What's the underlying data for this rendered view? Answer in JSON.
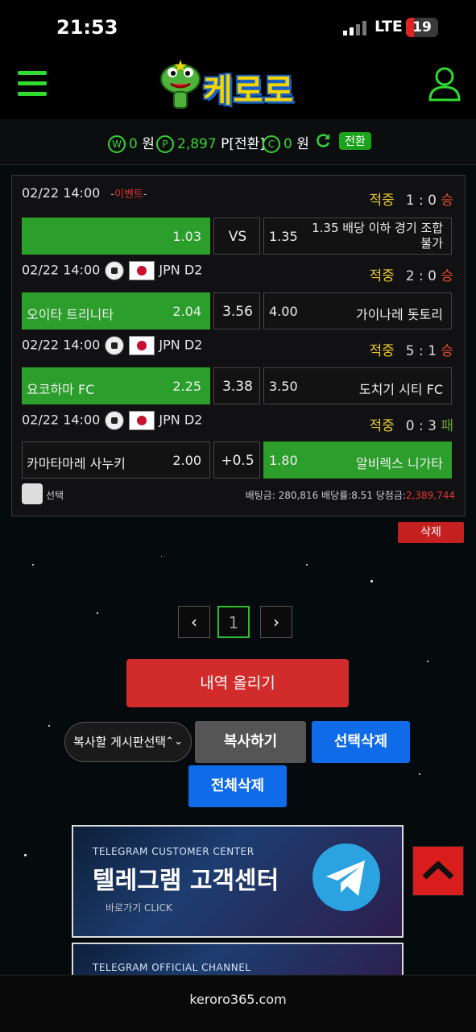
{
  "status_bar": {
    "time": "21:53",
    "network": "LTE",
    "battery": "19"
  },
  "header": {
    "logo_text": "케로로",
    "menu_icon": "hamburger-icon",
    "user_icon": "user-icon"
  },
  "points": {
    "won_value": "0",
    "won_unit": "원",
    "point_value": "2,897",
    "point_unit": "P[전환]",
    "coin_value": "0",
    "coin_unit": "원",
    "convert_label": "전환"
  },
  "bets": [
    {
      "date": "02/22 14:00",
      "league": "이벤트",
      "status": "적중",
      "score": "1 : 0",
      "outcome": "승",
      "home": "",
      "home_odds": "1.03",
      "mid": "VS",
      "away_odds": "1.35",
      "away": "1.35 배당 이하 경기 조합 불가"
    },
    {
      "date": "02/22 14:00",
      "league": "JPN D2",
      "status": "적중",
      "score": "2 : 0",
      "outcome": "승",
      "home": "오이타 트리니타",
      "home_odds": "2.04",
      "mid": "3.56",
      "away_odds": "4.00",
      "away": "가이나레 돗토리"
    },
    {
      "date": "02/22 14:00",
      "league": "JPN D2",
      "status": "적중",
      "score": "5 : 1",
      "outcome": "승",
      "home": "요코하마 FC",
      "home_odds": "2.25",
      "mid": "3.38",
      "away_odds": "3.50",
      "away": "도치기 시티 FC"
    },
    {
      "date": "02/22 14:00",
      "league": "JPN D2",
      "status": "적중",
      "score": "0 : 3",
      "outcome": "패",
      "home": "카마타마레 사누키",
      "home_odds": "2.00",
      "mid": "+0.5",
      "away_odds": "1.80",
      "away": "알비렉스 니가타"
    }
  ],
  "summary": {
    "select_label": "선택",
    "bet_amount_label": "배팅금:",
    "bet_amount": "280,816",
    "odds_label": "배당률:",
    "odds": "8.51",
    "win_label": "당첨금:",
    "win_amount": "2,389,744"
  },
  "delete_label": "삭제",
  "pagination": {
    "prev": "‹",
    "current": "1",
    "next": "›"
  },
  "upload_label": "내역 올리기",
  "board_select_placeholder": "복사할 게시판선택",
  "copy_label": "복사하기",
  "select_delete_label": "선택삭제",
  "all_delete_label": "전체삭제",
  "banner1": {
    "subtitle": "TELEGRAM CUSTOMER CENTER",
    "title": "텔레그램 고객센터",
    "link": "바로가기 CLICK"
  },
  "banner2": {
    "subtitle": "TELEGRAM OFFICIAL CHANNEL"
  },
  "footer_url": "keroro365.com",
  "colors": {
    "green": "#2b9e2b",
    "red": "#d12b2b",
    "blue": "#0f6be8",
    "gold": "#e8c82e"
  }
}
